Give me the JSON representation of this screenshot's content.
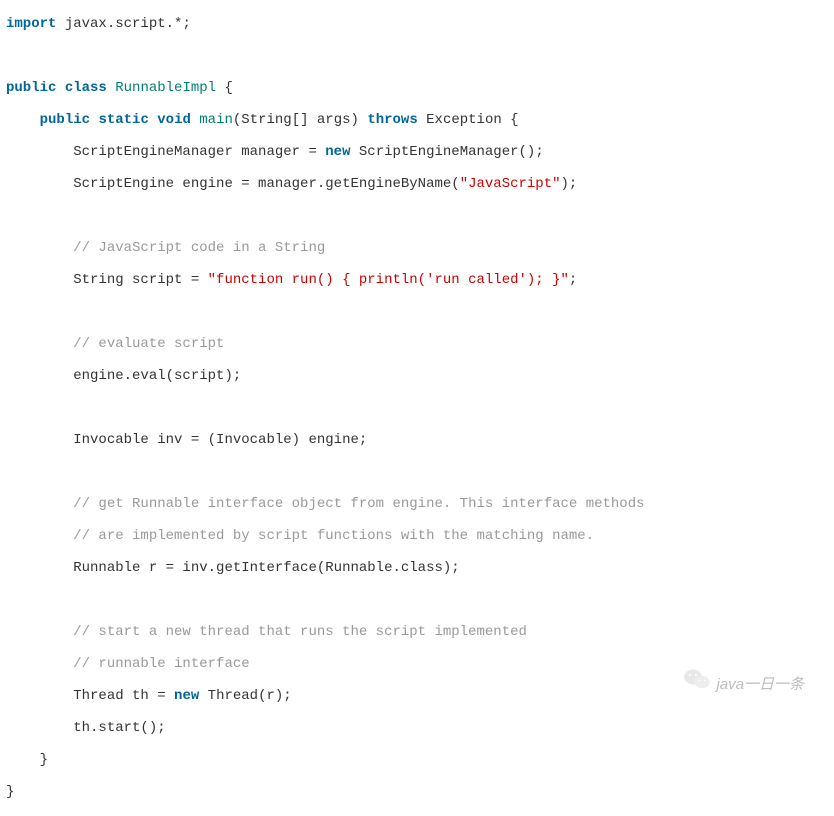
{
  "code": {
    "l1_kw": "import",
    "l1_rest": " javax.script.*;",
    "l2_kw1": "public",
    "l2_kw2": "class",
    "l2_cls": "RunnableImpl",
    "l2_rest": " {",
    "l3_kw1": "public",
    "l3_kw2": "static",
    "l3_kw3": "void",
    "l3_cls": "main",
    "l3_mid": "(String[] args) ",
    "l3_kw4": "throws",
    "l3_rest": " Exception {",
    "l4_mid": "ScriptEngineManager manager = ",
    "l4_kw": "new",
    "l4_rest": " ScriptEngineManager();",
    "l5_mid": "ScriptEngine engine = manager.getEngineByName(",
    "l5_str": "\"JavaScript\"",
    "l5_rest": ");",
    "l6_cmt": "// JavaScript code in a String",
    "l7_mid": "String script = ",
    "l7_str": "\"function run() { println('run called'); }\"",
    "l7_rest": ";",
    "l8_cmt": "// evaluate script",
    "l9_rest": "engine.eval(script);",
    "l10_rest": "Invocable inv = (Invocable) engine;",
    "l11_cmt": "// get Runnable interface object from engine. This interface methods",
    "l12_cmt": "// are implemented by script functions with the matching name.",
    "l13_rest": "Runnable r = inv.getInterface(Runnable.class);",
    "l14_cmt": "// start a new thread that runs the script implemented",
    "l15_cmt": "// runnable interface",
    "l16_mid": "Thread th = ",
    "l16_kw": "new",
    "l16_rest": " Thread(r);",
    "l17_rest": "th.start();",
    "l18_rest": "}",
    "l19_rest": "}"
  },
  "watermark": {
    "text": "java一日一条"
  }
}
